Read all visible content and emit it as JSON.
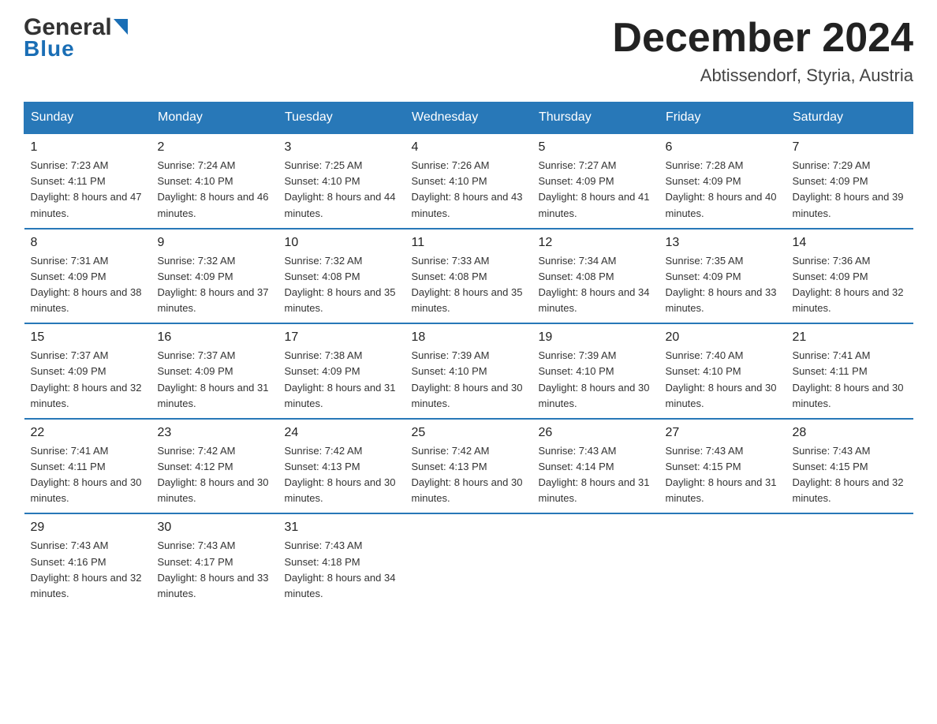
{
  "header": {
    "logo_general": "General",
    "logo_blue": "Blue",
    "month_title": "December 2024",
    "location": "Abtissendorf, Styria, Austria"
  },
  "weekdays": [
    "Sunday",
    "Monday",
    "Tuesday",
    "Wednesday",
    "Thursday",
    "Friday",
    "Saturday"
  ],
  "weeks": [
    [
      {
        "day": "1",
        "sunrise": "7:23 AM",
        "sunset": "4:11 PM",
        "daylight": "8 hours and 47 minutes."
      },
      {
        "day": "2",
        "sunrise": "7:24 AM",
        "sunset": "4:10 PM",
        "daylight": "8 hours and 46 minutes."
      },
      {
        "day": "3",
        "sunrise": "7:25 AM",
        "sunset": "4:10 PM",
        "daylight": "8 hours and 44 minutes."
      },
      {
        "day": "4",
        "sunrise": "7:26 AM",
        "sunset": "4:10 PM",
        "daylight": "8 hours and 43 minutes."
      },
      {
        "day": "5",
        "sunrise": "7:27 AM",
        "sunset": "4:09 PM",
        "daylight": "8 hours and 41 minutes."
      },
      {
        "day": "6",
        "sunrise": "7:28 AM",
        "sunset": "4:09 PM",
        "daylight": "8 hours and 40 minutes."
      },
      {
        "day": "7",
        "sunrise": "7:29 AM",
        "sunset": "4:09 PM",
        "daylight": "8 hours and 39 minutes."
      }
    ],
    [
      {
        "day": "8",
        "sunrise": "7:31 AM",
        "sunset": "4:09 PM",
        "daylight": "8 hours and 38 minutes."
      },
      {
        "day": "9",
        "sunrise": "7:32 AM",
        "sunset": "4:09 PM",
        "daylight": "8 hours and 37 minutes."
      },
      {
        "day": "10",
        "sunrise": "7:32 AM",
        "sunset": "4:08 PM",
        "daylight": "8 hours and 35 minutes."
      },
      {
        "day": "11",
        "sunrise": "7:33 AM",
        "sunset": "4:08 PM",
        "daylight": "8 hours and 35 minutes."
      },
      {
        "day": "12",
        "sunrise": "7:34 AM",
        "sunset": "4:08 PM",
        "daylight": "8 hours and 34 minutes."
      },
      {
        "day": "13",
        "sunrise": "7:35 AM",
        "sunset": "4:09 PM",
        "daylight": "8 hours and 33 minutes."
      },
      {
        "day": "14",
        "sunrise": "7:36 AM",
        "sunset": "4:09 PM",
        "daylight": "8 hours and 32 minutes."
      }
    ],
    [
      {
        "day": "15",
        "sunrise": "7:37 AM",
        "sunset": "4:09 PM",
        "daylight": "8 hours and 32 minutes."
      },
      {
        "day": "16",
        "sunrise": "7:37 AM",
        "sunset": "4:09 PM",
        "daylight": "8 hours and 31 minutes."
      },
      {
        "day": "17",
        "sunrise": "7:38 AM",
        "sunset": "4:09 PM",
        "daylight": "8 hours and 31 minutes."
      },
      {
        "day": "18",
        "sunrise": "7:39 AM",
        "sunset": "4:10 PM",
        "daylight": "8 hours and 30 minutes."
      },
      {
        "day": "19",
        "sunrise": "7:39 AM",
        "sunset": "4:10 PM",
        "daylight": "8 hours and 30 minutes."
      },
      {
        "day": "20",
        "sunrise": "7:40 AM",
        "sunset": "4:10 PM",
        "daylight": "8 hours and 30 minutes."
      },
      {
        "day": "21",
        "sunrise": "7:41 AM",
        "sunset": "4:11 PM",
        "daylight": "8 hours and 30 minutes."
      }
    ],
    [
      {
        "day": "22",
        "sunrise": "7:41 AM",
        "sunset": "4:11 PM",
        "daylight": "8 hours and 30 minutes."
      },
      {
        "day": "23",
        "sunrise": "7:42 AM",
        "sunset": "4:12 PM",
        "daylight": "8 hours and 30 minutes."
      },
      {
        "day": "24",
        "sunrise": "7:42 AM",
        "sunset": "4:13 PM",
        "daylight": "8 hours and 30 minutes."
      },
      {
        "day": "25",
        "sunrise": "7:42 AM",
        "sunset": "4:13 PM",
        "daylight": "8 hours and 30 minutes."
      },
      {
        "day": "26",
        "sunrise": "7:43 AM",
        "sunset": "4:14 PM",
        "daylight": "8 hours and 31 minutes."
      },
      {
        "day": "27",
        "sunrise": "7:43 AM",
        "sunset": "4:15 PM",
        "daylight": "8 hours and 31 minutes."
      },
      {
        "day": "28",
        "sunrise": "7:43 AM",
        "sunset": "4:15 PM",
        "daylight": "8 hours and 32 minutes."
      }
    ],
    [
      {
        "day": "29",
        "sunrise": "7:43 AM",
        "sunset": "4:16 PM",
        "daylight": "8 hours and 32 minutes."
      },
      {
        "day": "30",
        "sunrise": "7:43 AM",
        "sunset": "4:17 PM",
        "daylight": "8 hours and 33 minutes."
      },
      {
        "day": "31",
        "sunrise": "7:43 AM",
        "sunset": "4:18 PM",
        "daylight": "8 hours and 34 minutes."
      },
      null,
      null,
      null,
      null
    ]
  ]
}
